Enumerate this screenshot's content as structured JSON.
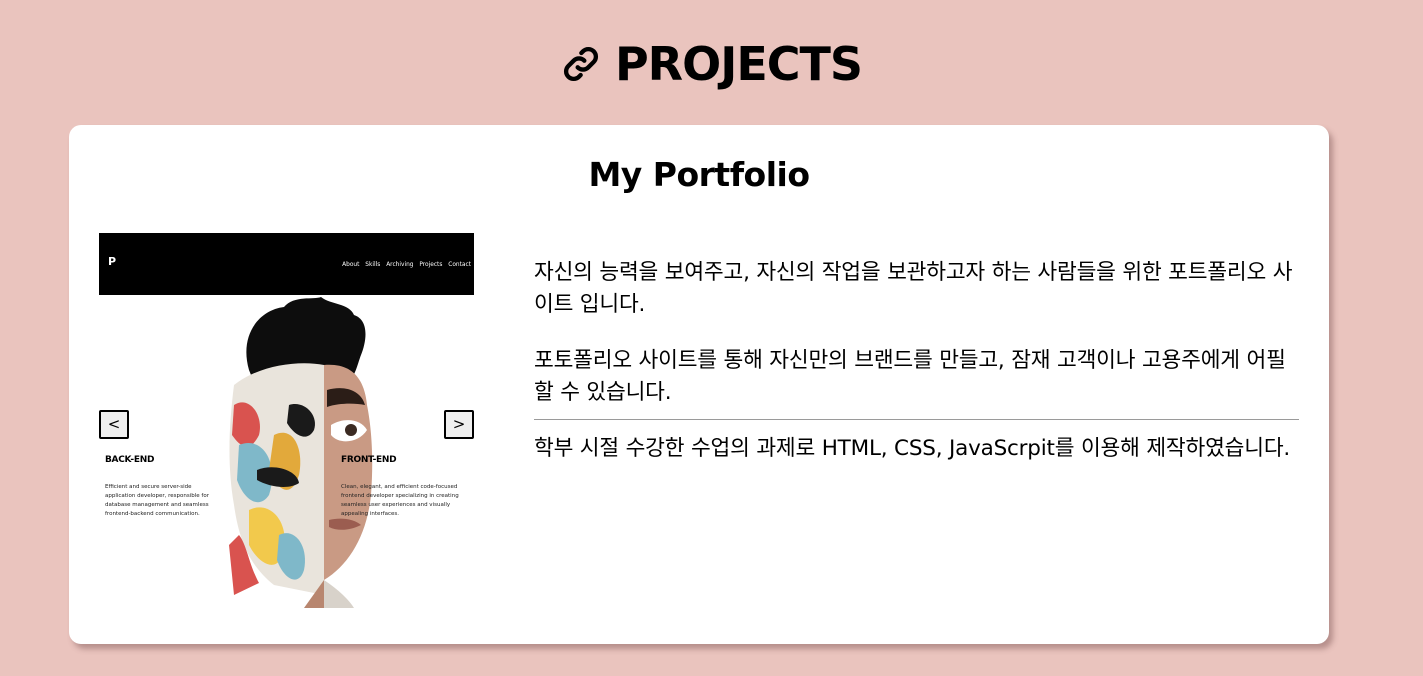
{
  "section": {
    "title": "PROJECTS",
    "icon": "link-icon"
  },
  "project": {
    "title": "My Portfolio",
    "slider": {
      "prev_label": "<",
      "next_label": ">",
      "screenshot": {
        "logo": "P",
        "menu": [
          "About",
          "Skills",
          "Archiving",
          "Projects",
          "Contact"
        ],
        "left_heading": "BACK-END",
        "left_text": "Efficient and secure server-side application developer, responsible for database management and seamless frontend-backend communication.",
        "right_heading": "FRONT-END",
        "right_text": "Clean, elegant, and efficient code-focused frontend developer specializing in creating seamless user experiences and visually appealing interfaces."
      }
    },
    "description": [
      "자신의 능력을 보여주고, 자신의 작업을 보관하고자 하는 사람들을 위한 포트폴리오 사이트 입니다.",
      "포토폴리오 사이트를 통해 자신만의 브랜드를 만들고, 잠재 고객이나 고용주에게 어필할 수 있습니다.",
      "학부 시절 수강한 수업의 과제로 HTML, CSS, JavaScrpit를 이용해 제작하였습니다."
    ]
  },
  "colors": {
    "background": "#eac4be",
    "card": "#ffffff",
    "text": "#000000"
  }
}
